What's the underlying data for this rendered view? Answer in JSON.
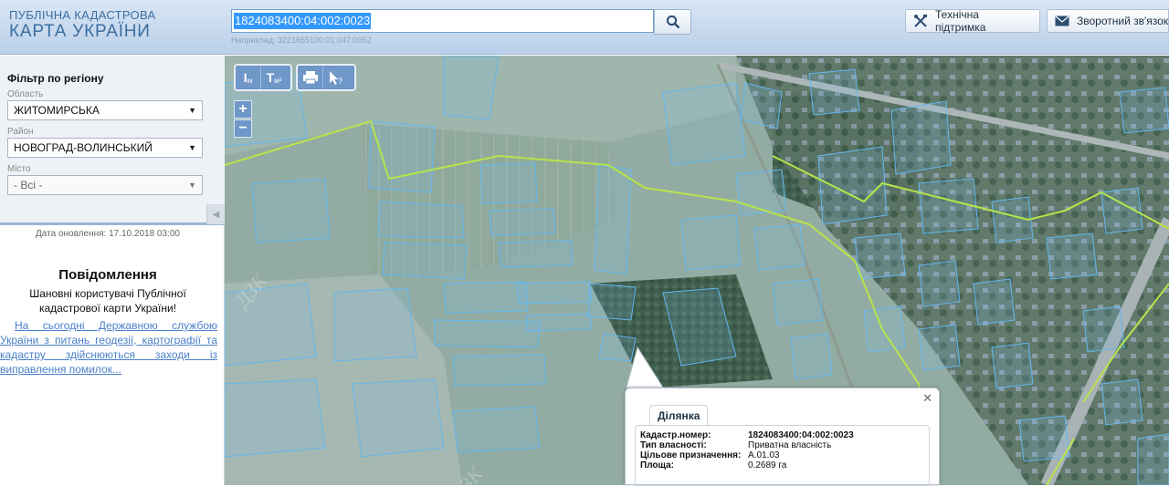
{
  "header": {
    "logo_line1": "ПУБЛІЧНА КАДАСТРОВА",
    "logo_line2": "КАРТА УКРАЇНИ",
    "search_value": "1824083400:04:002:0023",
    "search_hint": "Наприклад: 3221655100:01:047:0052",
    "support_label": "Технічна підтримка",
    "feedback_label": "Зворотний зв'язок"
  },
  "filter": {
    "title": "Фільтр по регіону",
    "oblast_label": "Область",
    "oblast_value": "ЖИТОМИРСЬКА",
    "rayon_label": "Район",
    "rayon_value": "НОВОГРАД-ВОЛИНСЬКИЙ",
    "misto_label": "Місто",
    "misto_value": "- Всі -"
  },
  "sidebar": {
    "updated": "Дата оновлення: 17.10.2018 03:00",
    "notice_title": "Повідомлення",
    "notice_text": "Шановні користувачі Публічної кадастрової карти України!",
    "notice_link": "На сьогодні Державною службою України з питань геодезії, картографії та кадастру здійснюються заходи із виправлення помилок..."
  },
  "toolbar": {
    "measure_m": "м",
    "measure_m2": "м²",
    "zoom_in": "+",
    "zoom_out": "−"
  },
  "popup": {
    "tab_label": "Ділянка",
    "rows": [
      {
        "key": "Кадастр.номер:",
        "value": "1824083400:04:002:0023"
      },
      {
        "key": "Тип власності:",
        "value": "Приватна власність"
      },
      {
        "key": "Цільове призначення:",
        "value": "A.01.03"
      },
      {
        "key": "Площа:",
        "value": "0.2689 га"
      }
    ]
  },
  "colors": {
    "parcel_outline": "#63b8f0",
    "boundary_line": "#b6e44a",
    "toolbar_blue": "#6f97c8"
  }
}
